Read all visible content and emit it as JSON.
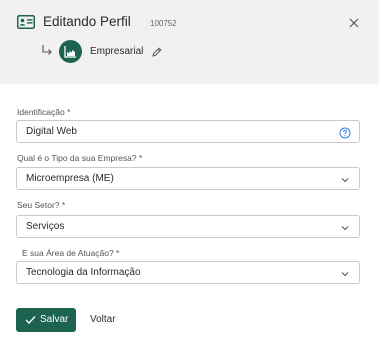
{
  "header": {
    "title": "Editando Perfil",
    "record_id": "100752",
    "profile_type": "Empresarial"
  },
  "form": {
    "identificacao": {
      "label": "Identificação *",
      "value": "Digital Web"
    },
    "tipo_empresa": {
      "label": "Qual é o Tipo da sua Empresa? *",
      "value": "Microempresa (ME)"
    },
    "setor": {
      "label": "Seu Setor? *",
      "value": "Serviços"
    },
    "area_atuacao": {
      "label": "E sua Área de Atuação? *",
      "value": "Tecnologia da Informação"
    }
  },
  "actions": {
    "save_label": "Salvar",
    "back_label": "Voltar"
  },
  "colors": {
    "accent": "#1d6450",
    "header_bg": "#f1f1f1",
    "help_icon": "#2a7de1"
  },
  "icons": {
    "header": "id-card-icon",
    "close": "close-icon",
    "sub": "subdirectory-arrow-icon",
    "avatar": "factory-icon",
    "edit": "pencil-icon",
    "help": "help-circle-icon",
    "dropdown": "chevron-down-icon",
    "save": "check-icon"
  }
}
